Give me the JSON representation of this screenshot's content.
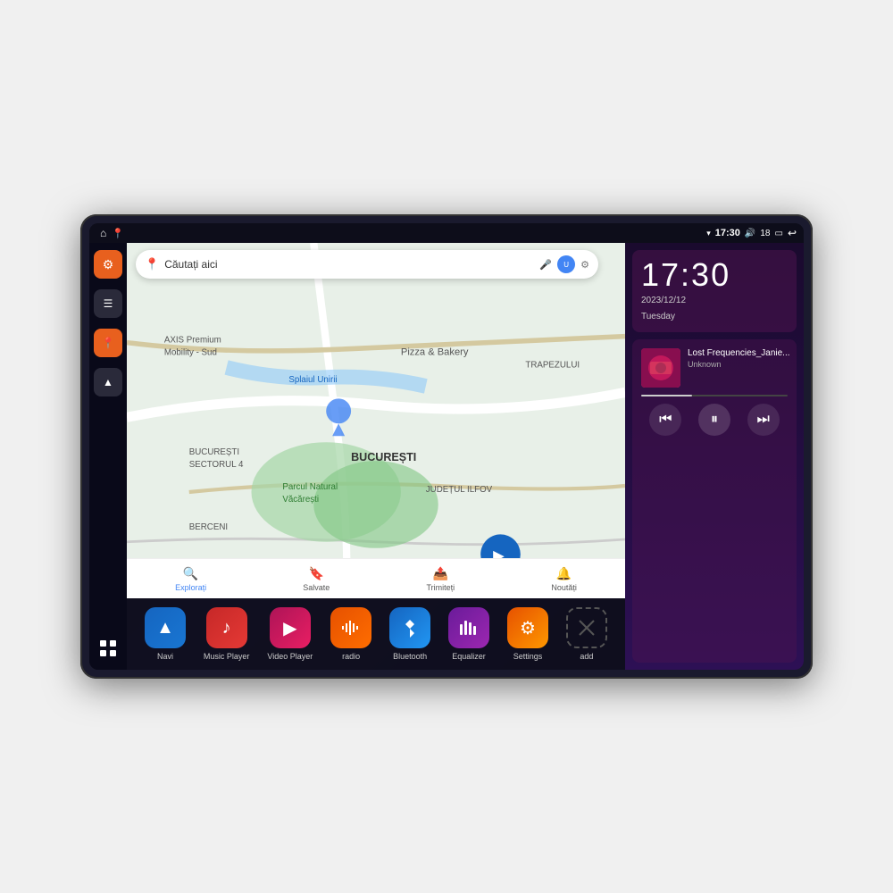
{
  "device": {
    "status_bar": {
      "home_icon": "⌂",
      "map_icon": "📍",
      "wifi_icon": "▾",
      "time": "17:30",
      "volume_icon": "🔊",
      "battery_level": "18",
      "battery_icon": "🔋",
      "back_icon": "↩"
    },
    "sidebar": {
      "items": [
        {
          "icon": "⚙",
          "type": "orange",
          "label": "settings"
        },
        {
          "icon": "☰",
          "type": "dark",
          "label": "menu"
        },
        {
          "icon": "📍",
          "type": "orange",
          "label": "navigation"
        },
        {
          "icon": "▲",
          "type": "dark",
          "label": "arrow"
        }
      ],
      "grid_icon": "⊞"
    },
    "map": {
      "search_placeholder": "Căutați aici",
      "locations": [
        "AXIS Premium Mobility - Sud",
        "Parcul Natural Văcărești",
        "Pizza & Bakery",
        "BUCUREȘTI",
        "JUDEȚUL ILFOV",
        "BUCUREȘTI SECTORUL 4",
        "BERCENI",
        "TRAPEZULUI"
      ],
      "nav_items": [
        {
          "label": "Explorați",
          "icon": "🔍",
          "active": true
        },
        {
          "label": "Salvate",
          "icon": "🔖",
          "active": false
        },
        {
          "label": "Trimiteți",
          "icon": "📤",
          "active": false
        },
        {
          "label": "Noutăți",
          "icon": "🔔",
          "active": false
        }
      ]
    },
    "clock": {
      "time": "17:30",
      "date": "2023/12/12",
      "day": "Tuesday"
    },
    "music": {
      "title": "Lost Frequencies_Janie...",
      "artist": "Unknown",
      "controls": {
        "prev": "⏮",
        "play": "⏸",
        "next": "⏭"
      }
    },
    "apps": [
      {
        "id": "navi",
        "label": "Navi",
        "icon": "▲",
        "color_class": "blue-nav"
      },
      {
        "id": "music-player",
        "label": "Music Player",
        "icon": "♪",
        "color_class": "red-music"
      },
      {
        "id": "video-player",
        "label": "Video Player",
        "icon": "▶",
        "color_class": "pink-video"
      },
      {
        "id": "radio",
        "label": "radio",
        "icon": "📻",
        "color_class": "orange-radio"
      },
      {
        "id": "bluetooth",
        "label": "Bluetooth",
        "icon": "₿",
        "color_class": "blue-bt"
      },
      {
        "id": "equalizer",
        "label": "Equalizer",
        "icon": "🎚",
        "color_class": "purple-eq"
      },
      {
        "id": "settings",
        "label": "Settings",
        "icon": "⚙",
        "color_class": "orange-settings"
      },
      {
        "id": "add",
        "label": "add",
        "icon": "+",
        "color_class": "gray-add"
      }
    ]
  }
}
